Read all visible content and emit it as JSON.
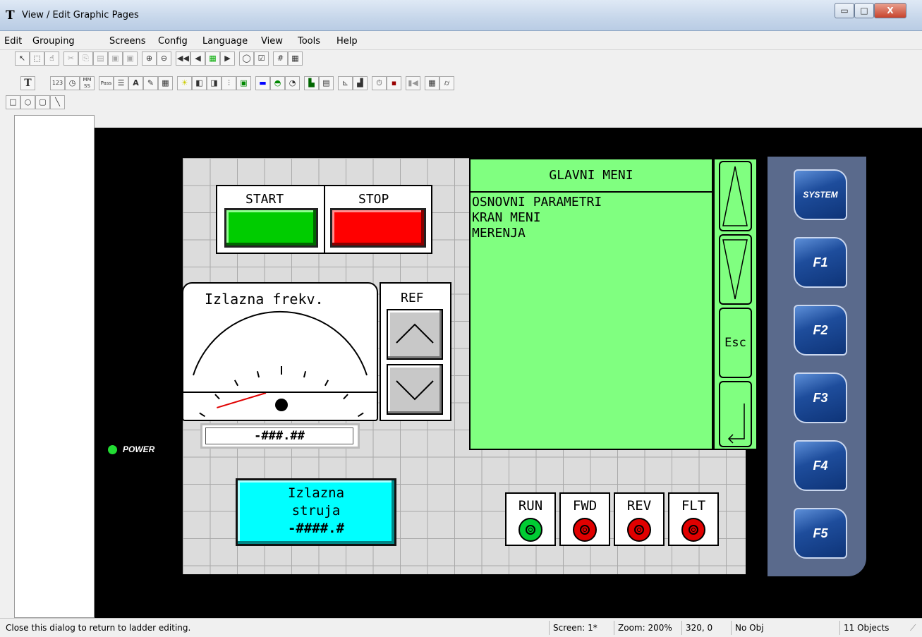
{
  "window": {
    "logo": "T",
    "title": "View / Edit Graphic Pages",
    "minimize_glyph": "▭",
    "maximize_glyph": "□",
    "close_glyph": "X"
  },
  "menu": [
    "Edit",
    "Grouping",
    "Screens",
    "Config",
    "Language",
    "View",
    "Tools",
    "Help"
  ],
  "toolbar_icons": {
    "row1": [
      "arrow-pointer-icon",
      "select-rect-icon",
      "hand-icon",
      "cut-icon",
      "copy-icon",
      "paste-icon",
      "bring-front-icon",
      "send-back-icon",
      "zoom-in-icon",
      "zoom-out-icon",
      "first-page-icon",
      "prev-page-icon",
      "screen-grid-icon",
      "next-page-icon",
      "speech-icon",
      "check-icon",
      "grid-icon",
      "grid-fine-icon"
    ],
    "row2": [
      "text-tool-icon",
      "numeric-123-icon",
      "clock-icon",
      "mm-ss-icon",
      "password-icon",
      "list-icon",
      "text-font-icon",
      "edit-icon",
      "table-icon",
      "lightbulb-icon",
      "switch-icon",
      "multi-switch-icon",
      "slider-icon",
      "bitmap-icon",
      "bar-icon",
      "dome-icon",
      "gauge-icon",
      "picture-icon",
      "folder-icon",
      "trend-icon",
      "chart-icon",
      "timer-icon",
      "save-icon",
      "video-icon",
      "table-grid-icon",
      "cylinder-icon"
    ],
    "row3": [
      "rectangle-icon",
      "ellipse-icon",
      "rounded-rect-icon",
      "line-icon"
    ],
    "labels": {
      "text": "T",
      "num": "123",
      "mmss": "MM SS",
      "pass": "Pass",
      "font": "A"
    }
  },
  "screen": {
    "start_label": "START",
    "stop_label": "STOP",
    "gauge_title": "Izlazna frekv.",
    "gauge_needle_fraction": 0.08,
    "freq_value": "-###.##",
    "ref_label": "REF",
    "menu_title": "GLAVNI MENI",
    "menu_items": [
      "OSNOVNI PARAMETRI",
      "KRAN MENI",
      "MERENJA"
    ],
    "esc_label": "Esc",
    "current_title_1": "Izlazna",
    "current_title_2": "struja",
    "current_value": "-####.#",
    "indicators": [
      {
        "label": "RUN",
        "color": "#00cc33"
      },
      {
        "label": "FWD",
        "color": "#e00000"
      },
      {
        "label": "REV",
        "color": "#e00000"
      },
      {
        "label": "FLT",
        "color": "#e00000"
      }
    ],
    "power_label": "POWER",
    "fkeys": [
      "SYSTEM",
      "F1",
      "F2",
      "F3",
      "F4",
      "F5"
    ]
  },
  "status": {
    "message": "Close this dialog to return to ladder editing.",
    "screen": "Screen: 1*",
    "zoom": "Zoom: 200%",
    "coords": "320, 0",
    "object": "No Obj",
    "count": "11 Objects"
  },
  "colors": {
    "start": "#00cc00",
    "stop": "#ff0000",
    "menu_bg": "#80ff80",
    "cyan": "#00ffff",
    "fkey_panel": "#5a6a8c"
  }
}
